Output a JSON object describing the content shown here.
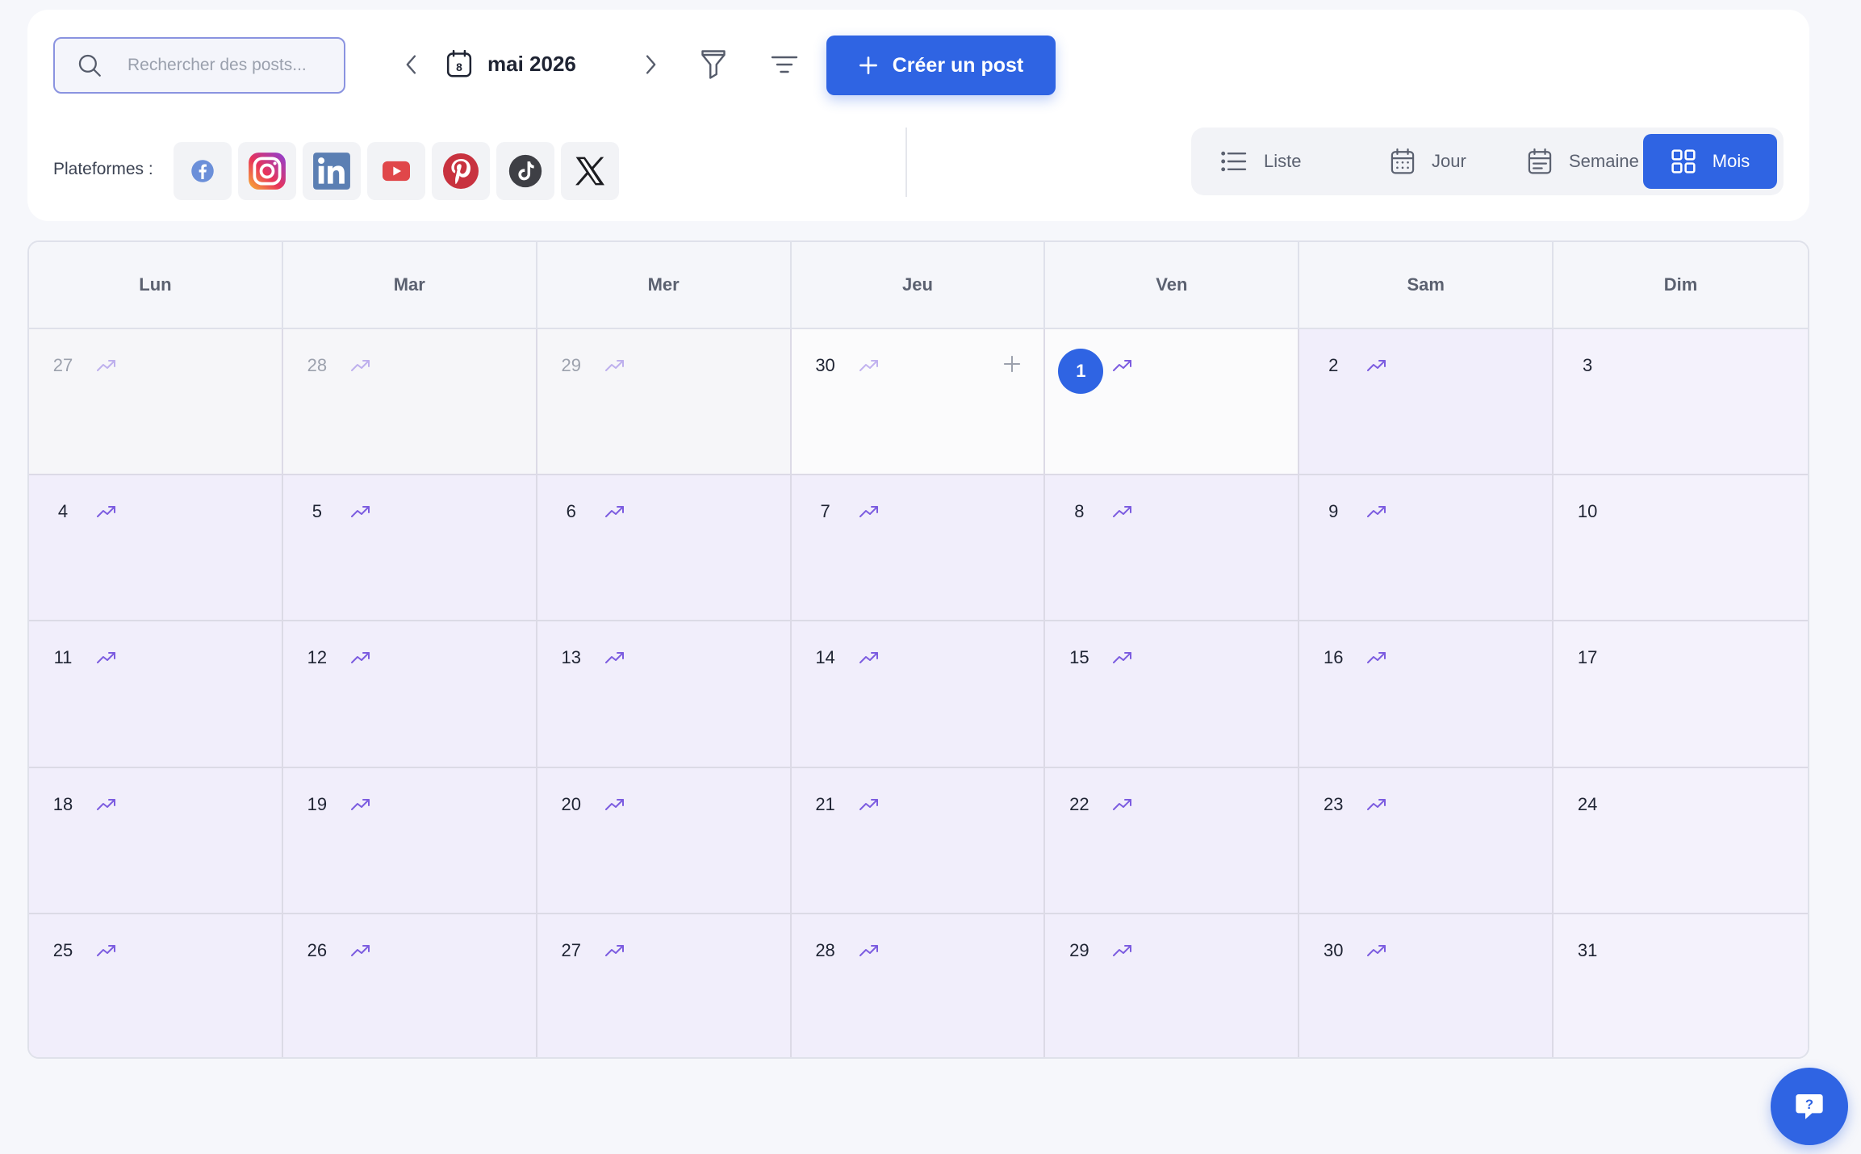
{
  "search": {
    "placeholder": "Rechercher des posts..."
  },
  "header": {
    "month_label": "mai 2026",
    "calendar_icon_day": "8",
    "create_label": "Créer un post"
  },
  "platforms": {
    "label": "Plateformes :",
    "items": [
      "facebook-icon",
      "instagram-icon",
      "linkedin-icon",
      "youtube-icon",
      "pinterest-icon",
      "tiktok-icon",
      "x-icon"
    ]
  },
  "views": {
    "items": [
      {
        "label": "Liste",
        "icon": "list-icon"
      },
      {
        "label": "Jour",
        "icon": "calendar-day-icon"
      },
      {
        "label": "Semaine",
        "icon": "calendar-week-icon"
      },
      {
        "label": "Mois",
        "icon": "grid-icon"
      }
    ],
    "active": "Mois"
  },
  "calendar": {
    "weekdays": [
      "Lun",
      "Mar",
      "Mer",
      "Jeu",
      "Ven",
      "Sam",
      "Dim"
    ],
    "weeks": [
      [
        "27",
        "28",
        "29",
        "30",
        "1",
        "2",
        "3"
      ],
      [
        "4",
        "5",
        "6",
        "7",
        "8",
        "9",
        "10"
      ],
      [
        "11",
        "12",
        "13",
        "14",
        "15",
        "16",
        "17"
      ],
      [
        "18",
        "19",
        "20",
        "21",
        "22",
        "23",
        "24"
      ],
      [
        "25",
        "26",
        "27",
        "28",
        "29",
        "30",
        "31"
      ]
    ],
    "today": "1"
  },
  "colors": {
    "accent": "#2f64e3",
    "trend": "#7c5ce0",
    "cell_bg": "#f1eefb"
  }
}
